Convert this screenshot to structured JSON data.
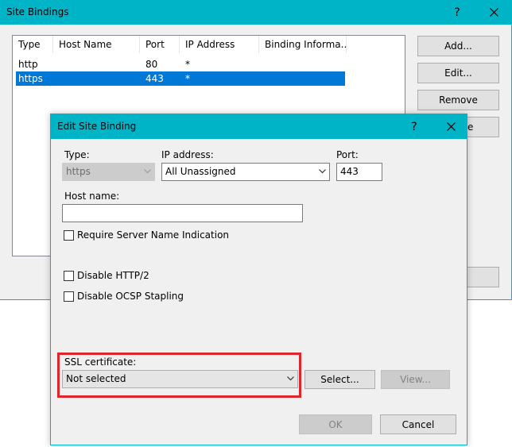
{
  "site_bindings": {
    "title": "Site Bindings",
    "help_glyph": "?",
    "columns": [
      "Type",
      "Host Name",
      "Port",
      "IP Address",
      "Binding Informa..."
    ],
    "rows": [
      {
        "type": "http",
        "host": "",
        "port": "80",
        "ip": "*",
        "info": ""
      },
      {
        "type": "https",
        "host": "",
        "port": "443",
        "ip": "*",
        "info": ""
      }
    ],
    "buttons": {
      "add": "Add...",
      "edit": "Edit...",
      "remove": "Remove",
      "browse_partial": "e"
    }
  },
  "edit_binding": {
    "title": "Edit Site Binding",
    "help_glyph": "?",
    "type_label": "Type:",
    "type_value": "https",
    "ip_label": "IP address:",
    "ip_value": "All Unassigned",
    "port_label": "Port:",
    "port_value": "443",
    "host_label": "Host name:",
    "host_value": "",
    "sni_label": "Require Server Name Indication",
    "http2_label": "Disable HTTP/2",
    "ocsp_label": "Disable OCSP Stapling",
    "ssl_label": "SSL certificate:",
    "ssl_value": "Not selected",
    "select_button": "Select...",
    "view_button": "View...",
    "ok_button": "OK",
    "cancel_button": "Cancel"
  },
  "colors": {
    "titlebar": "#00b4c8",
    "selection": "#0078d7",
    "highlight": "#e0242b"
  }
}
